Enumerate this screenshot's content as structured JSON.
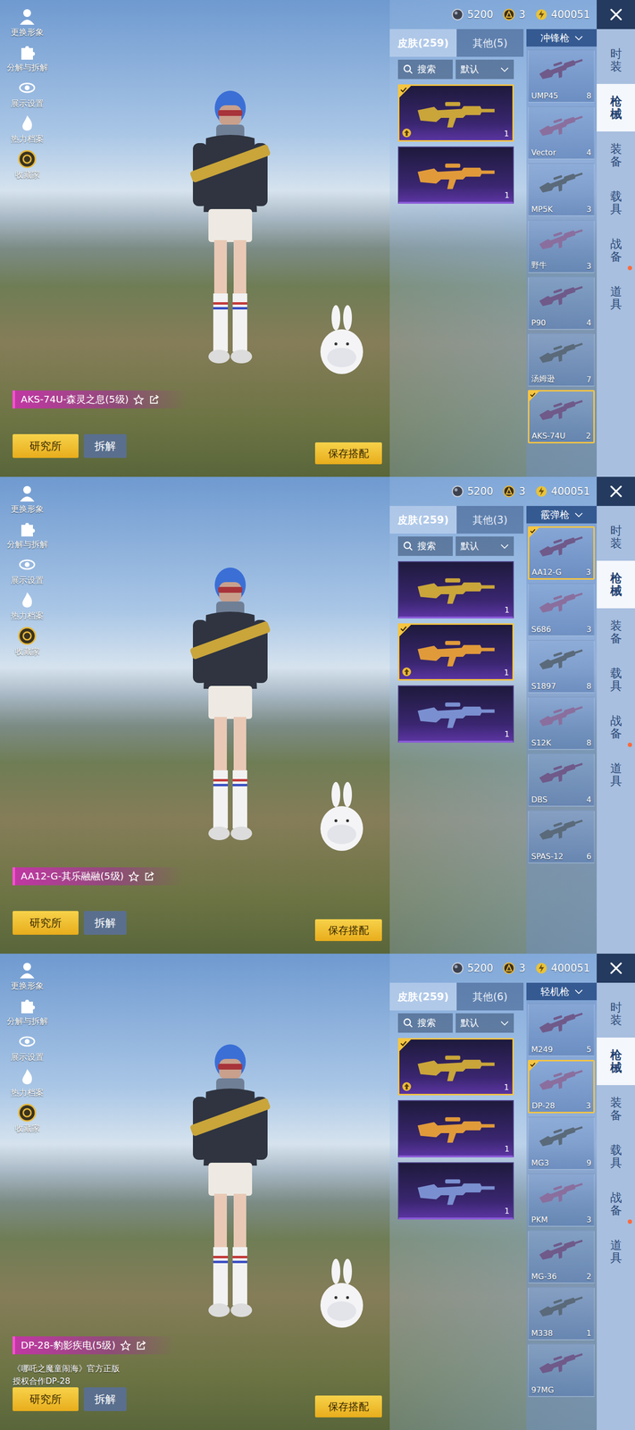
{
  "panels": [
    {
      "left_tools": [
        {
          "label": "更换形象"
        },
        {
          "label": "分解与拆解"
        },
        {
          "label": "展示设置"
        },
        {
          "label": "热力档案"
        },
        {
          "label": "收藏家"
        }
      ],
      "currency": [
        {
          "amount": "5200"
        },
        {
          "amount": "3"
        },
        {
          "amount": "400051"
        }
      ],
      "nav_tabs": [
        {
          "label": "时装",
          "selected": false,
          "badge": false
        },
        {
          "label": "枪械",
          "selected": true,
          "badge": false
        },
        {
          "label": "装备",
          "selected": false,
          "badge": false
        },
        {
          "label": "载具",
          "selected": false,
          "badge": false
        },
        {
          "label": "战备",
          "selected": false,
          "badge": true
        },
        {
          "label": "道具",
          "selected": false,
          "badge": false
        }
      ],
      "skin_tabs": [
        {
          "label": "皮肤(259)",
          "selected": true
        },
        {
          "label": "其他(5)",
          "selected": false
        }
      ],
      "search": {
        "placeholder": "搜索"
      },
      "sort": "默认",
      "skins": [
        {
          "count": "1",
          "selected": true,
          "upgradable": true
        },
        {
          "count": "1",
          "selected": false,
          "upgradable": false
        }
      ],
      "category": "冲锋枪",
      "guns": [
        {
          "name": "UMP45",
          "count": "8",
          "selected": false
        },
        {
          "name": "Vector",
          "count": "4",
          "selected": false
        },
        {
          "name": "MP5K",
          "count": "3",
          "selected": false
        },
        {
          "name": "野牛",
          "count": "3",
          "selected": false
        },
        {
          "name": "P90",
          "count": "4",
          "selected": false
        },
        {
          "name": "汤姆逊",
          "count": "7",
          "selected": false
        },
        {
          "name": "AKS-74U",
          "count": "2",
          "selected": true
        }
      ],
      "item_name": "AKS-74U-森灵之息(5级)",
      "note": [],
      "buttons": {
        "lab": "研究所",
        "dismantle": "拆解",
        "save": "保存搭配"
      }
    },
    {
      "left_tools": [
        {
          "label": "更换形象"
        },
        {
          "label": "分解与拆解"
        },
        {
          "label": "展示设置"
        },
        {
          "label": "热力档案"
        },
        {
          "label": "收藏家"
        }
      ],
      "currency": [
        {
          "amount": "5200"
        },
        {
          "amount": "3"
        },
        {
          "amount": "400051"
        }
      ],
      "nav_tabs": [
        {
          "label": "时装",
          "selected": false,
          "badge": false
        },
        {
          "label": "枪械",
          "selected": true,
          "badge": false
        },
        {
          "label": "装备",
          "selected": false,
          "badge": false
        },
        {
          "label": "载具",
          "selected": false,
          "badge": false
        },
        {
          "label": "战备",
          "selected": false,
          "badge": true
        },
        {
          "label": "道具",
          "selected": false,
          "badge": false
        }
      ],
      "skin_tabs": [
        {
          "label": "皮肤(259)",
          "selected": true
        },
        {
          "label": "其他(3)",
          "selected": false
        }
      ],
      "search": {
        "placeholder": "搜索"
      },
      "sort": "默认",
      "skins": [
        {
          "count": "1",
          "selected": false,
          "upgradable": false
        },
        {
          "count": "1",
          "selected": true,
          "upgradable": true
        },
        {
          "count": "1",
          "selected": false,
          "upgradable": false
        }
      ],
      "category": "霰弹枪",
      "guns": [
        {
          "name": "AA12-G",
          "count": "3",
          "selected": true
        },
        {
          "name": "S686",
          "count": "3",
          "selected": false
        },
        {
          "name": "S1897",
          "count": "8",
          "selected": false
        },
        {
          "name": "S12K",
          "count": "8",
          "selected": false
        },
        {
          "name": "DBS",
          "count": "4",
          "selected": false
        },
        {
          "name": "SPAS-12",
          "count": "6",
          "selected": false
        }
      ],
      "item_name": "AA12-G-其乐融融(5级)",
      "note": [],
      "buttons": {
        "lab": "研究所",
        "dismantle": "拆解",
        "save": "保存搭配"
      }
    },
    {
      "left_tools": [
        {
          "label": "更换形象"
        },
        {
          "label": "分解与拆解"
        },
        {
          "label": "展示设置"
        },
        {
          "label": "热力档案"
        },
        {
          "label": "收藏家"
        }
      ],
      "currency": [
        {
          "amount": "5200"
        },
        {
          "amount": "3"
        },
        {
          "amount": "400051"
        }
      ],
      "nav_tabs": [
        {
          "label": "时装",
          "selected": false,
          "badge": false
        },
        {
          "label": "枪械",
          "selected": true,
          "badge": false
        },
        {
          "label": "装备",
          "selected": false,
          "badge": false
        },
        {
          "label": "载具",
          "selected": false,
          "badge": false
        },
        {
          "label": "战备",
          "selected": false,
          "badge": true
        },
        {
          "label": "道具",
          "selected": false,
          "badge": false
        }
      ],
      "skin_tabs": [
        {
          "label": "皮肤(259)",
          "selected": true
        },
        {
          "label": "其他(6)",
          "selected": false
        }
      ],
      "search": {
        "placeholder": "搜索"
      },
      "sort": "默认",
      "skins": [
        {
          "count": "1",
          "selected": true,
          "upgradable": true
        },
        {
          "count": "1",
          "selected": false,
          "upgradable": false
        },
        {
          "count": "1",
          "selected": false,
          "upgradable": false
        }
      ],
      "category": "轻机枪",
      "guns": [
        {
          "name": "M249",
          "count": "5",
          "selected": false
        },
        {
          "name": "DP-28",
          "count": "3",
          "selected": true
        },
        {
          "name": "MG3",
          "count": "9",
          "selected": false
        },
        {
          "name": "PKM",
          "count": "3",
          "selected": false
        },
        {
          "name": "MG-36",
          "count": "2",
          "selected": false
        },
        {
          "name": "M338",
          "count": "1",
          "selected": false
        },
        {
          "name": "97MG",
          "count": "",
          "selected": false
        }
      ],
      "item_name": "DP-28-豹影疾电(5级)",
      "note": [
        "《哪吒之魔童闹海》官方正版",
        "授权合作DP-28"
      ],
      "buttons": {
        "lab": "研究所",
        "dismantle": "拆解",
        "save": "保存搭配"
      }
    }
  ]
}
